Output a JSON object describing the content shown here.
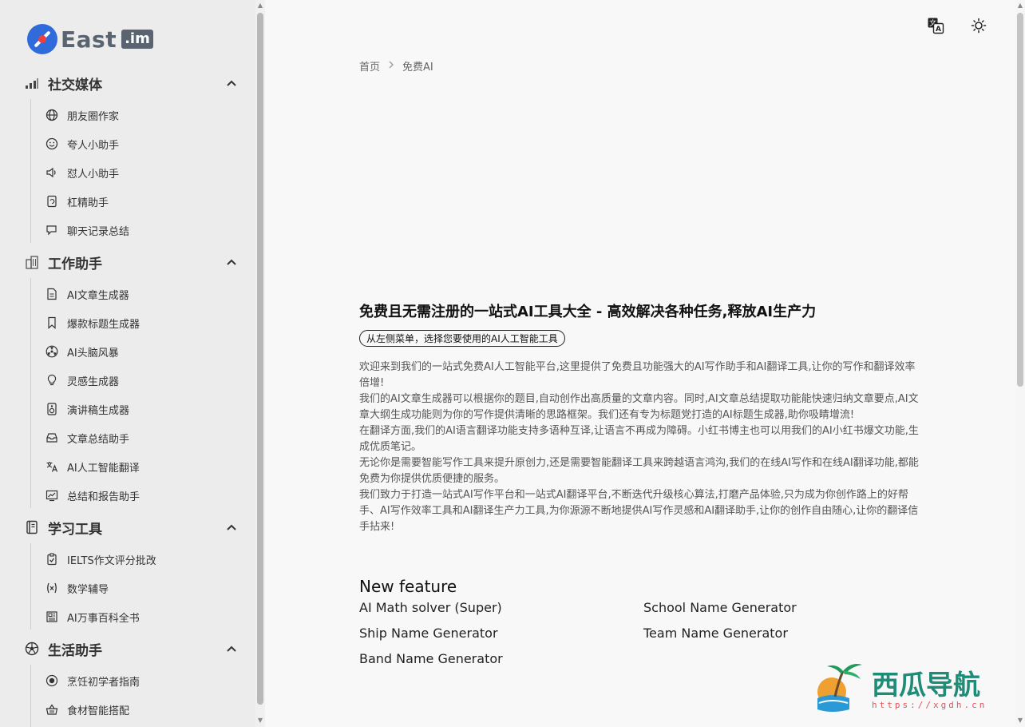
{
  "logo": {
    "text": "East",
    "suffix": ".im"
  },
  "breadcrumb": {
    "home": "首页",
    "current": "免费AI"
  },
  "sections": [
    {
      "title": "社交媒体",
      "icon": "signal-bars-icon",
      "items": [
        {
          "label": "朋友圈作家",
          "icon": "globe-icon"
        },
        {
          "label": "夸人小助手",
          "icon": "smile-icon"
        },
        {
          "label": "怼人小助手",
          "icon": "speaker-icon"
        },
        {
          "label": "杠精助手",
          "icon": "refresh-doc-icon"
        },
        {
          "label": "聊天记录总结",
          "icon": "chat-icon"
        }
      ]
    },
    {
      "title": "工作助手",
      "icon": "building-icon",
      "items": [
        {
          "label": "AI文章生成器",
          "icon": "document-icon"
        },
        {
          "label": "爆款标题生成器",
          "icon": "bookmark-icon"
        },
        {
          "label": "AI头脑风暴",
          "icon": "radiation-icon"
        },
        {
          "label": "灵感生成器",
          "icon": "lightbulb-icon"
        },
        {
          "label": "演讲稿生成器",
          "icon": "speaker-box-icon"
        },
        {
          "label": "文章总结助手",
          "icon": "inbox-icon"
        },
        {
          "label": "AI人工智能翻译",
          "icon": "translate-icon"
        },
        {
          "label": "总结和报告助手",
          "icon": "chart-icon"
        }
      ]
    },
    {
      "title": "学习工具",
      "icon": "notebook-icon",
      "items": [
        {
          "label": "IELTS作文评分批改",
          "icon": "clipboard-check-icon"
        },
        {
          "label": "数学辅导",
          "icon": "variable-icon"
        },
        {
          "label": "AI万事百科全书",
          "icon": "newspaper-icon"
        }
      ]
    },
    {
      "title": "生活助手",
      "icon": "soccer-ball-icon",
      "items": [
        {
          "label": "烹饪初学者指南",
          "icon": "cooking-icon"
        },
        {
          "label": "食材智能搭配",
          "icon": "basket-icon"
        }
      ]
    }
  ],
  "main": {
    "title": "免费且无需注册的一站式AI工具大全 - 高效解决各种任务,释放AI生产力",
    "pill": "从左侧菜单，选择您要使用的AI人工智能工具",
    "paragraphs": [
      "欢迎来到我们的一站式免费AI人工智能平台,这里提供了免费且功能强大的AI写作助手和AI翻译工具,让你的写作和翻译效率倍增!",
      "我们的AI文章生成器可以根据你的题目,自动创作出高质量的文章内容。同时,AI文章总结提取功能能快速归纳文章要点,AI文章大纲生成功能则为你的写作提供清晰的思路框架。我们还有专为标题党打造的AI标题生成器,助你吸睛增流!",
      "在翻译方面,我们的AI语言翻译功能支持多语种互译,让语言不再成为障碍。小红书博主也可以用我们的AI小红书爆文功能,生成优质笔记。",
      "无论你是需要智能写作工具来提升原创力,还是需要智能翻译工具来跨越语言鸿沟,我们的在线AI写作和在线AI翻译功能,都能免费为你提供优质便捷的服务。",
      "我们致力于打造一站式AI写作平台和一站式AI翻译平台,不断迭代升级核心算法,打磨产品体验,只为成为你创作路上的好帮手、AI写作效率工具和AI翻译生产力工具,为你源源不断地提供AI写作灵感和AI翻译助手,让你的创作自由随心,让你的翻译信手拈来!"
    ],
    "new_feature": {
      "title": "New feature",
      "items": [
        "AI Math solver (Super)",
        "School Name Generator",
        "Ship Name Generator",
        "Team Name Generator",
        "Band Name Generator"
      ]
    }
  },
  "watermark": {
    "text": "西瓜导航",
    "url": "https://xgdh.cn"
  }
}
